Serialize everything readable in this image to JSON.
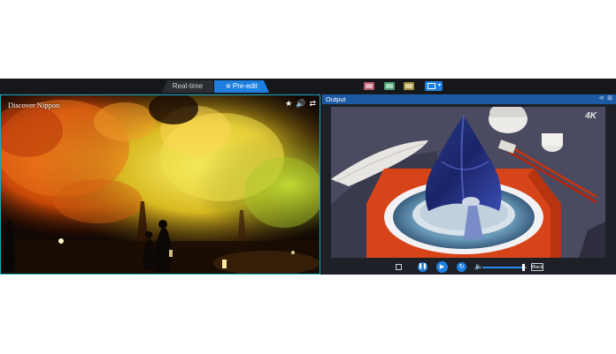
{
  "tabs": {
    "realtime": "Real-time",
    "preedit": "Pre-edit"
  },
  "layouts": [
    "layout-option-1",
    "layout-option-2",
    "layout-option-3",
    "layout-option-4-active"
  ],
  "source": {
    "title": "Discover Nippon",
    "icons": [
      "star-icon",
      "speaker-icon",
      "sync-icon"
    ]
  },
  "output": {
    "title": "Output",
    "badge": "4K",
    "header_icons": [
      "pin-icon",
      "close-icon"
    ]
  },
  "playback": {
    "black_label": "Black",
    "volume_level": 0.92,
    "icons": [
      "crop-icon",
      "pause-icon",
      "play-icon",
      "loop-icon",
      "volume-icon"
    ]
  },
  "colors": {
    "accent": "#1e7fe0",
    "selection_border": "#17a9c6",
    "output_header": "#1c5aa6"
  }
}
